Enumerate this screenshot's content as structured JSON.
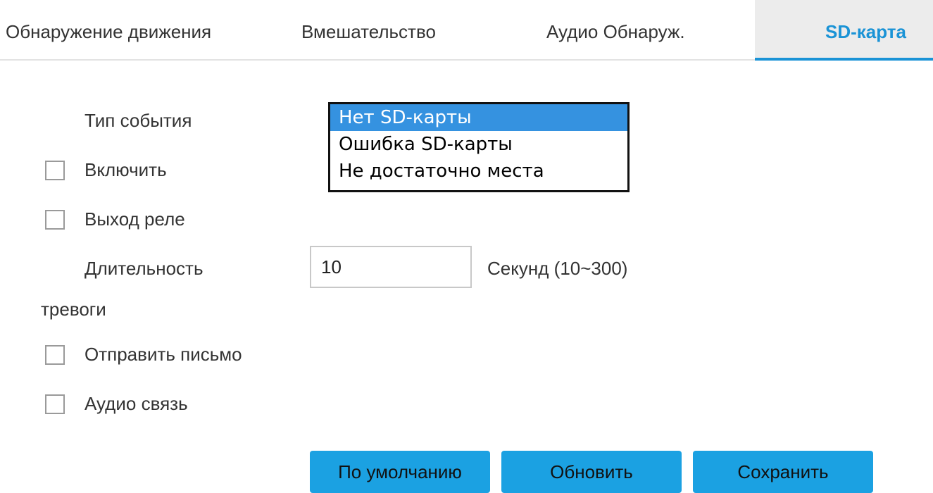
{
  "tabs": [
    {
      "label": "Обнаружение движения"
    },
    {
      "label": "Вмешательство"
    },
    {
      "label": "Аудио Обнаруж."
    },
    {
      "label": "SD-карта",
      "active": true
    }
  ],
  "form": {
    "event_type_label": "Тип события",
    "event_type_options": [
      "Нет SD-карты",
      "Ошибка SD-карты",
      "Не достаточно места"
    ],
    "event_type_selected": "Нет SD-карты",
    "enable_label": "Включить",
    "enable_checked": false,
    "relay_label": "Выход реле",
    "relay_checked": false,
    "alarm_duration_label_line1": "Длительность",
    "alarm_duration_label_line2": "тревоги",
    "alarm_duration_value": "10",
    "alarm_duration_hint": "Секунд (10~300)",
    "send_email_label": "Отправить письмо",
    "send_email_checked": false,
    "audio_label": "Аудио связь",
    "audio_checked": false
  },
  "buttons": {
    "default_label": "По умолчанию",
    "refresh_label": "Обновить",
    "save_label": "Сохранить"
  },
  "colors": {
    "accent": "#1a93d6",
    "button": "#1ba1e2",
    "selected_option": "#3592e0"
  }
}
